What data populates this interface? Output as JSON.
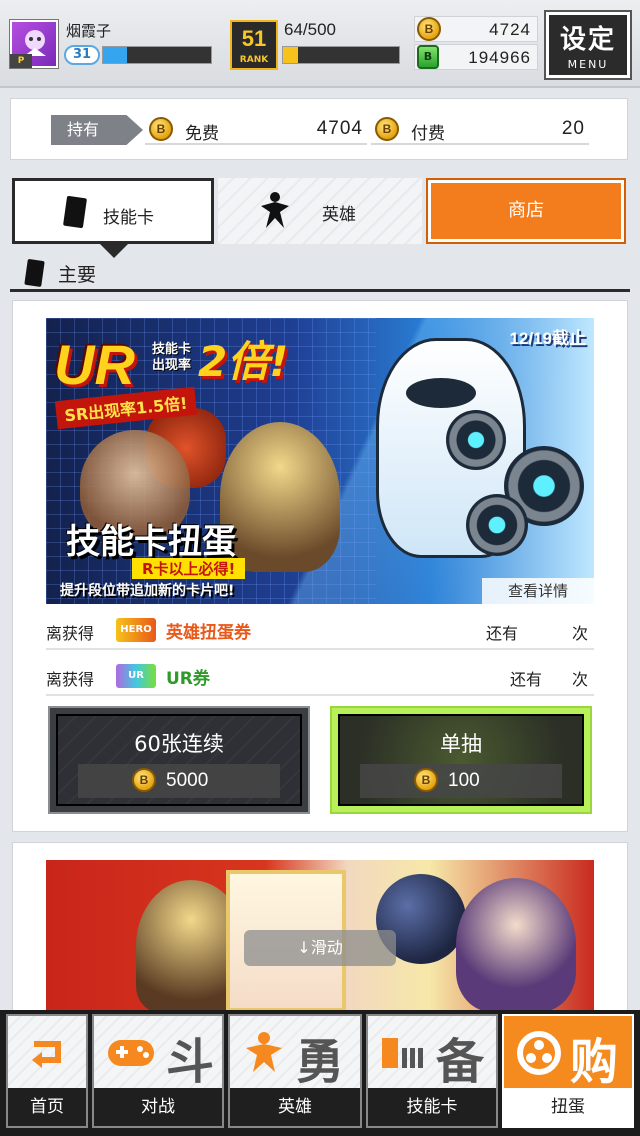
{
  "header": {
    "player_name": "烟霞子",
    "level": "31",
    "xp_progress": 0.22,
    "rank_number": "51",
    "rank_label": "RANK",
    "stamina": "64/500",
    "stamina_progress": 0.13,
    "coins": "4724",
    "gems": "194966",
    "menu_big": "设定",
    "menu_small": "MENU",
    "avatar_tag": "P"
  },
  "holdings": {
    "label": "持有",
    "free_label": "免费",
    "free_value": "4704",
    "paid_label": "付费",
    "paid_value": "20"
  },
  "tabs": {
    "skill_card": "技能卡",
    "hero": "英雄",
    "shop": "商店"
  },
  "section": {
    "title": "主要"
  },
  "banner": {
    "ur_logo": "UR",
    "ur_sub1": "技能卡\n出现率",
    "ur_2x": "2倍!",
    "ur_sub2": "SR出现率1.5倍!",
    "deadline": "12/19截止",
    "title": "技能卡扭蛋",
    "guarantee": "R卡以上必得!",
    "footer": "提升段位带追加新的卡片吧!",
    "detail_link": "查看详情"
  },
  "tickets": [
    {
      "prefix": "离获得",
      "icon_text": "HERO",
      "name": "英雄扭蛋券",
      "remain": "还有",
      "unit": "次",
      "color": "#e8591a"
    },
    {
      "prefix": "离获得",
      "icon_text": "UR",
      "name": "UR券",
      "remain": "还有",
      "unit": "次",
      "color": "#2f9a2a"
    }
  ],
  "pulls": {
    "multi_title": "60张连续",
    "multi_cost": "5000",
    "single_title": "单抽",
    "single_cost": "100"
  },
  "scroll_hint": "↓滑动",
  "nav": {
    "home": "首页",
    "battle": "对战",
    "hero": "英雄",
    "skill_card": "技能卡",
    "gacha": "扭蛋",
    "battle_big": "斗",
    "hero_big": "勇",
    "skill_big": "备",
    "gacha_big": "购"
  },
  "colors": {
    "accent_orange": "#f37c1c",
    "xp_blue": "#35a5f0",
    "stamina_yellow": "#f6c21b",
    "single_glow": "#b8f05a"
  }
}
